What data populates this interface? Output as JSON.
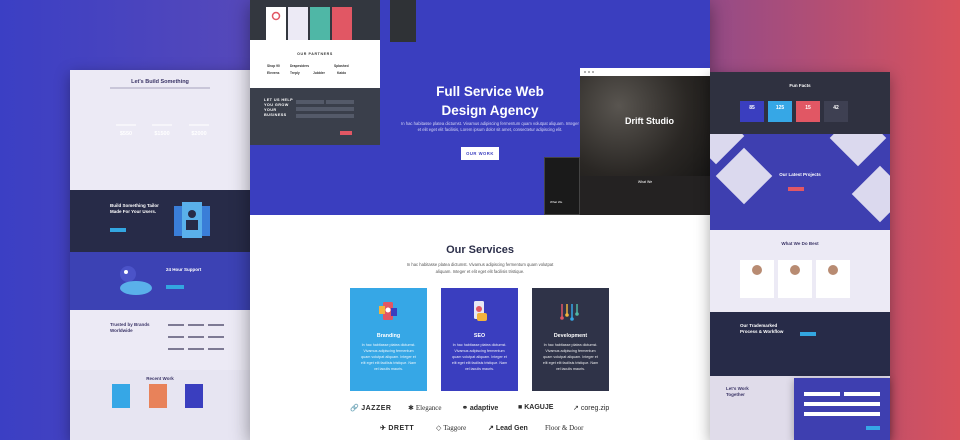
{
  "left_page": {
    "pricing_title": "Let's Build Something",
    "prices": [
      {
        "value": "$550",
        "color": "#3bb47e"
      },
      {
        "value": "$1500",
        "color": "#3a3ebf"
      },
      {
        "value": "$2000",
        "color": "#2c3050"
      }
    ],
    "tailor_title": "Build Something Tailor Made For Your Users.",
    "support_title": "24 Hour Support",
    "trusted_title": "Trusted by Brands Worldwide",
    "recent_title": "Recent Work"
  },
  "center_page": {
    "mini_partners_title": "OUR PARTNERS",
    "mini_partner_logos": [
      "Shop 90",
      "Drapesiders",
      "Splashed",
      "Elevens",
      "Treply",
      "Jubbler",
      "Kaido"
    ],
    "mini_form_title": "LET US HELP YOU GROW YOUR BUSINESS",
    "hero": {
      "title_line1": "Full Service Web",
      "title_line2": "Design Agency",
      "description": "In hac habitasse platea dictumst. Vivamus adipiscing fermentum quam volutpat aliquam. Integer et elit eget elit facilisis, Lorem ipsum dolor sit amet, consectetur adipiscing elit.",
      "button": "OUR WORK"
    },
    "drift": {
      "title": "Drift Studio",
      "section": "What We",
      "phone_text": "What We"
    },
    "services": {
      "title": "Our Services",
      "description": "In hac habitasse platea dictumst. Vivamus adipiscing fermentum quam volutpat aliquam. Integer et elit eget elit facilisis tristique.",
      "cards": [
        {
          "name": "Branding",
          "desc": "In hac habitasse platea dictumst. Vivamus adipiscing fermentum quam volutpat aliquam. Integer et elit eget elit facilisis tristique. Nam vel iaculis mauris.",
          "color": "#36a7e6"
        },
        {
          "name": "SEO",
          "desc": "In hac habitasse platea dictumst. Vivamus adipiscing fermentum quam volutpat aliquam. Integer et elit eget elit facilisis tristique. Nam vel iaculis mauris.",
          "color": "#3a3ebf"
        },
        {
          "name": "Development",
          "desc": "In hac habitasse platea dictumst. Vivamus adipiscing fermentum quam volutpat aliquam. Integer et elit eget elit facilisis tristique. Nam vel iaculis mauris.",
          "color": "#2f3348"
        }
      ]
    },
    "brands_row1": [
      {
        "icon": "🔗",
        "name": "JAZZER"
      },
      {
        "icon": "✱",
        "name": "Elegance"
      },
      {
        "icon": "⚭",
        "name": "adaptive"
      },
      {
        "icon": "■",
        "name": "KAGUJE"
      },
      {
        "icon": "↗",
        "name": "coreg.zip"
      }
    ],
    "brands_row2": [
      {
        "icon": "✈",
        "name": "DRETT"
      },
      {
        "icon": "◇",
        "name": "Taggore"
      },
      {
        "icon": "↗",
        "name": "Lead Gen"
      },
      {
        "icon": "",
        "name": "Floor & Door"
      }
    ]
  },
  "right_page": {
    "facts_title": "Fun Facts",
    "facts": [
      {
        "value": "85",
        "color": "#3a3ebf"
      },
      {
        "value": "125",
        "color": "#36a7e6"
      },
      {
        "value": "15",
        "color": "#e15764"
      },
      {
        "value": "42",
        "color": "#3e4052"
      }
    ],
    "projects_title": "Our Latest Projects",
    "best_title": "What We Do Best",
    "process_title": "Our Trademarked Process & Workflow",
    "together_title": "Let's Work Together"
  }
}
